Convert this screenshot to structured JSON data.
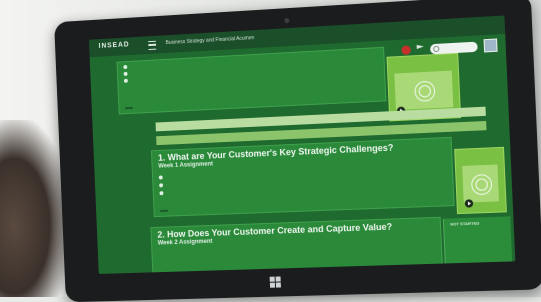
{
  "app": {
    "logo_text": "INSEAD",
    "course_title": "Business Strategy and Financial Acumen"
  },
  "topbar_icons": [
    "menu-icon",
    "notification-icon",
    "flag-icon",
    "search-icon",
    "avatar"
  ],
  "cards": [
    {
      "title": "",
      "rows": [
        "",
        "",
        ""
      ],
      "view_label": ""
    },
    {
      "title": "1. What are Your Customer's Key Strategic Challenges?",
      "subtitle": "Week 1 Assignment",
      "view_label": ""
    },
    {
      "title": "2. How Does Your Customer Create and Capture Value?",
      "subtitle": "Week 2 Assignment",
      "status": "NOT STARTED"
    }
  ],
  "colors": {
    "screen_bg": "#1f6a2e",
    "card_bg": "#2a8a3a",
    "accent_light": "#7ac043",
    "notification": "#c9302c"
  }
}
